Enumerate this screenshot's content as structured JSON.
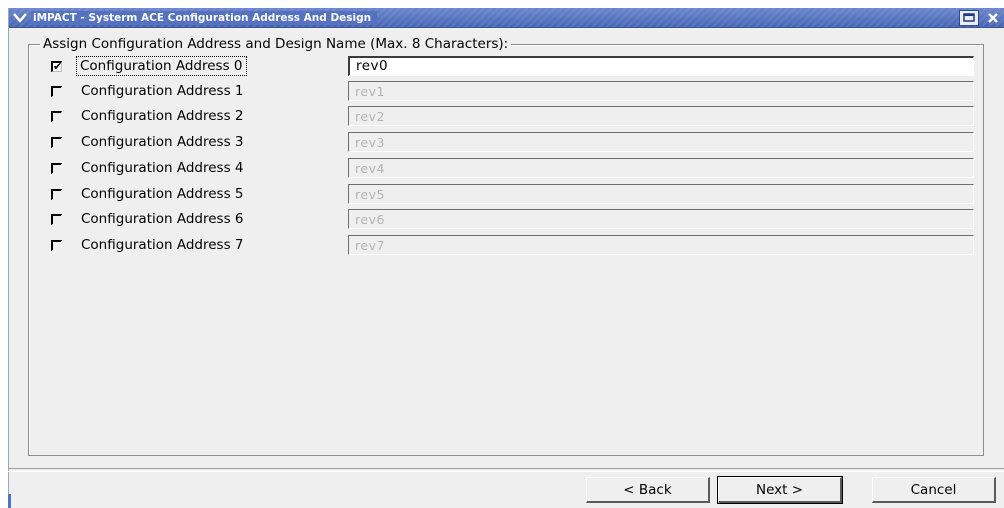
{
  "window": {
    "title": "iMPACT - Systerm ACE Configuration Address And Design",
    "title_bar_color": "#4a68b8"
  },
  "group": {
    "label": "Assign Configuration Address and Design Name (Max. 8 Characters):"
  },
  "rows": [
    {
      "label": "Configuration Address 0",
      "checked": true,
      "value": "rev0"
    },
    {
      "label": "Configuration Address 1",
      "checked": false,
      "value": "rev1"
    },
    {
      "label": "Configuration Address 2",
      "checked": false,
      "value": "rev2"
    },
    {
      "label": "Configuration Address 3",
      "checked": false,
      "value": "rev3"
    },
    {
      "label": "Configuration Address 4",
      "checked": false,
      "value": "rev4"
    },
    {
      "label": "Configuration Address 5",
      "checked": false,
      "value": "rev5"
    },
    {
      "label": "Configuration Address 6",
      "checked": false,
      "value": "rev6"
    },
    {
      "label": "Configuration Address 7",
      "checked": false,
      "value": "rev7"
    }
  ],
  "buttons": {
    "back": "< Back",
    "next": "Next >",
    "cancel": "Cancel"
  },
  "icons": {
    "menu": "chevron-down-icon",
    "maximize": "maximize-icon",
    "close": "close-icon"
  }
}
